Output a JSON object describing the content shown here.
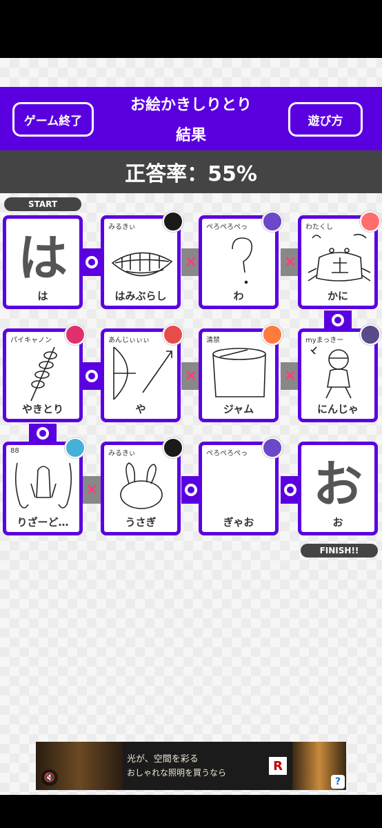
{
  "header": {
    "end_button": "ゲーム終了",
    "title": "お絵かきしりとり",
    "subtitle": "結果",
    "howto_button": "遊び方"
  },
  "score": {
    "text": "正答率：55%",
    "percent": 55
  },
  "labels": {
    "start": "START",
    "finish": "FINISH!!"
  },
  "cards": [
    {
      "answer": "は",
      "author": "",
      "type": "letter",
      "letter": "は"
    },
    {
      "answer": "はみぶらし",
      "author": "みるきぃ",
      "type": "drawing",
      "avatar_color": "#1a1a1a",
      "drawing": "teeth-drawing"
    },
    {
      "answer": "わ",
      "author": "ぺろぺろぺっ",
      "type": "drawing",
      "avatar_color": "#6a48c8",
      "drawing": "question-mark-drawing"
    },
    {
      "answer": "かに",
      "author": "わたくし",
      "type": "drawing",
      "avatar_color": "#ff6d6d",
      "drawing": "crab-drawing"
    },
    {
      "answer": "にんじゃ",
      "author": "myまっきー",
      "type": "drawing",
      "avatar_color": "#5a4a8a",
      "drawing": "ninja-drawing"
    },
    {
      "answer": "ジャム",
      "author": "清禁",
      "type": "drawing",
      "avatar_color": "#ff7a3c",
      "drawing": "jam-jar-drawing"
    },
    {
      "answer": "や",
      "author": "あんじぃぃぃ",
      "type": "drawing",
      "avatar_color": "#e84b4b",
      "drawing": "bow-arrow-drawing"
    },
    {
      "answer": "やきとり",
      "author": "パイキャノン",
      "type": "drawing",
      "avatar_color": "#e03070",
      "drawing": "yakitori-drawing"
    },
    {
      "answer": "りざーど…",
      "author": "88",
      "type": "drawing",
      "avatar_color": "#46b0d8",
      "drawing": "lizard-drawing"
    },
    {
      "answer": "うさぎ",
      "author": "みるきぃ",
      "type": "drawing",
      "avatar_color": "#1a1a1a",
      "drawing": "rabbit-drawing"
    },
    {
      "answer": "ぎゃお",
      "author": "ぺろぺろぺっ",
      "type": "drawing",
      "avatar_color": "#6a48c8",
      "drawing": "blank-drawing"
    },
    {
      "answer": "お",
      "author": "",
      "type": "letter",
      "letter": "お"
    }
  ],
  "connectors": [
    {
      "result": "correct",
      "symbol": ""
    },
    {
      "result": "wrong",
      "symbol": "×"
    },
    {
      "result": "wrong",
      "symbol": "×"
    },
    {
      "result": "correct",
      "symbol": ""
    },
    {
      "result": "wrong",
      "symbol": "×"
    },
    {
      "result": "wrong",
      "symbol": "×"
    },
    {
      "result": "correct",
      "symbol": ""
    },
    {
      "result": "correct",
      "symbol": ""
    },
    {
      "result": "wrong",
      "symbol": "×"
    },
    {
      "result": "correct",
      "symbol": ""
    },
    {
      "result": "correct",
      "symbol": ""
    }
  ],
  "ad": {
    "line1": "光が、空間を彩る",
    "line2": "おしゃれな照明を買うなら",
    "logo": "R",
    "help": "?",
    "mute": "🔇",
    "colors": {
      "bg": "#1b1b1b",
      "warm": "#c88a3c"
    }
  },
  "colors": {
    "primary": "#5a00e0",
    "score_bg": "#444444",
    "wrong_mark": "#ff3c7a",
    "wrong_bg": "#888888"
  }
}
